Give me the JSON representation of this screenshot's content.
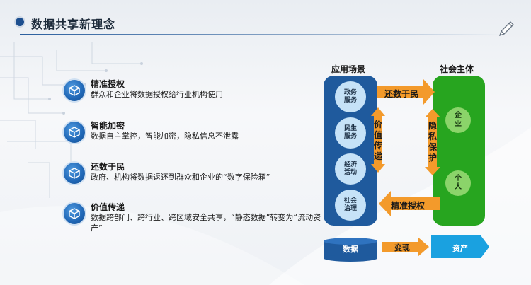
{
  "header": {
    "title": "数据共享新理念"
  },
  "features": [
    {
      "title": "精准授权",
      "desc": "群众和企业将数据授权给行业机构使用",
      "icon": "cube-icon"
    },
    {
      "title": "智能加密",
      "desc": "数据自主掌控，智能加密，隐私信息不泄露",
      "icon": "cube-icon"
    },
    {
      "title": "还数于民",
      "desc": "政府、机构将数据返还到群众和企业的“数字保险箱”",
      "icon": "cube-icon"
    },
    {
      "title": "价值传递",
      "desc": "数据跨部门、跨行业、跨区域安全共享，“静态数据”转变为“流动资产”",
      "icon": "cube-icon"
    }
  ],
  "diagram": {
    "left_label": "应用场景",
    "right_label": "社会主体",
    "scenarios": [
      "政务服务",
      "民生服务",
      "经济活动",
      "社会治理"
    ],
    "entities": [
      "企业",
      "个人"
    ],
    "top_arrow": "还数于民",
    "left_vertical": "价值传递",
    "right_vertical": "隐私保护",
    "bottom_arrow": "精准授权",
    "data_label": "数据",
    "convert_label": "变现",
    "asset_label": "资产",
    "colors": {
      "blue_panel": "#1f5a9d",
      "green_panel": "#27a51f",
      "arrow": "#f39a2b",
      "circle_blue": "#c6e2f7",
      "circle_green": "#8bd46a"
    }
  }
}
